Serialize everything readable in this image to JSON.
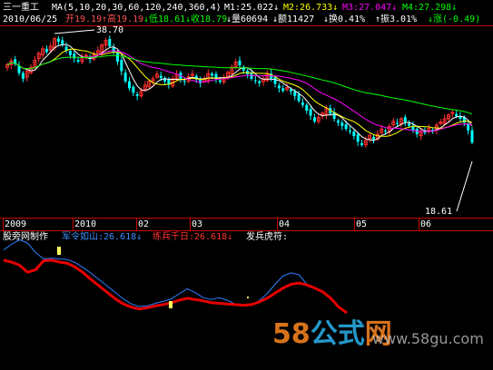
{
  "header": {
    "stock_name": "三一重工",
    "ma_label": "MA(5,10,20,30,60,120,240,360,4)",
    "m1": "M1:25.022↓",
    "m2": "M2:26.733↓",
    "m3": "M3:27.047↓",
    "m4": "M4:27.298↓",
    "date": "2010/06/25",
    "open": "开19.19",
    "high": "↑高19.19",
    "low": "↓低18.61",
    "close": "↓收18.79",
    "volume": "↓量60694",
    "amount": "↓额11427",
    "turnover": "↓换0.41%",
    "amplitude": "↑振3.01%",
    "change": "↓涨(-0.49)"
  },
  "colors": {
    "m1": "#ffffff",
    "m2": "#ffff00",
    "m3": "#ff00ff",
    "m4": "#00ff00",
    "up": "#ff3030",
    "down": "#00ffff",
    "bg": "#000000",
    "axis": "#c80000",
    "price_label": "#ffffff",
    "line_generals": "#2f7fff",
    "line_soldiers": "#e60000"
  },
  "indicator": {
    "title": "股旁网制作",
    "l1": "军令如山:26.618↓",
    "l2": "练兵千日:26.618↓",
    "l3": "发兵虎符:"
  },
  "watermark": {
    "part1": "58",
    "part2": "公式",
    "part3": "网",
    "url": "www.58gu.com"
  },
  "chart_data": [
    {
      "type": "candlestick",
      "title": "三一重工",
      "time_labels": [
        "2009",
        "2010",
        "02",
        "03",
        "04",
        "05",
        "06"
      ],
      "annotations": [
        {
          "label": "38.70",
          "kind": "period high"
        },
        {
          "label": "18.61",
          "kind": "period low"
        }
      ],
      "close": [
        33.8,
        34.4,
        33.9,
        32.5,
        31.6,
        32.8,
        33.4,
        34.5,
        35.6,
        36.3,
        35.8,
        36.7,
        37.9,
        37.4,
        36.9,
        36.0,
        35.3,
        34.8,
        34.3,
        34.9,
        35.3,
        34.7,
        35.4,
        36.0,
        36.9,
        37.6,
        36.7,
        35.8,
        34.3,
        32.8,
        31.2,
        30.1,
        29.4,
        28.9,
        29.7,
        30.6,
        31.2,
        31.6,
        32.3,
        31.7,
        31.2,
        30.7,
        31.6,
        32.3,
        31.5,
        31.2,
        31.9,
        32.3,
        31.5,
        30.9,
        31.5,
        32.4,
        32.1,
        31.6,
        31.1,
        31.7,
        32.6,
        33.4,
        34.2,
        33.7,
        32.9,
        32.3,
        31.6,
        31.2,
        30.9,
        31.6,
        32.4,
        31.6,
        30.8,
        30.1,
        29.7,
        30.2,
        29.6,
        28.9,
        28.1,
        27.5,
        26.6,
        25.8,
        24.9,
        25.5,
        26.2,
        27.0,
        26.1,
        25.3,
        24.7,
        24.2,
        23.7,
        23.3,
        22.6,
        21.7,
        21.2,
        21.9,
        22.7,
        22.1,
        22.9,
        23.7,
        23.3,
        24.1,
        24.9,
        24.5,
        25.3,
        24.8,
        24.2,
        23.5,
        22.9,
        23.4,
        23.1,
        23.8,
        23.5,
        24.3,
        24.8,
        25.3,
        25.9,
        26.3,
        25.7,
        25.3,
        24.7,
        23.5,
        21.6
      ],
      "ma": [
        {
          "name": "M1",
          "period": 5
        },
        {
          "name": "M2",
          "period": 10
        },
        {
          "name": "M3",
          "period": 20
        },
        {
          "name": "M4",
          "period": 60
        }
      ],
      "axes_ticks": false
    },
    {
      "type": "line",
      "title": "股旁网制作",
      "series": [
        {
          "name": "军令如山",
          "color": "#2f7fff",
          "values": [
            0.99,
            1.08,
            1.15,
            1.1,
            0.95,
            0.85,
            0.86,
            0.85,
            0.84,
            0.79,
            0.71,
            0.62,
            0.52,
            0.42,
            0.32,
            0.22,
            0.14,
            0.1,
            0.11,
            0.15,
            0.18,
            0.22,
            0.3,
            0.38,
            0.32,
            0.24,
            0.21,
            0.24,
            0.2,
            0.14,
            0.11,
            0.12,
            0.19,
            0.3,
            0.45,
            0.58,
            0.63,
            0.6,
            0.45,
            0.38,
            0.33,
            0.23,
            0.09,
            0.0
          ]
        },
        {
          "name": "练兵千日",
          "color": "#e60000",
          "values": [
            0.83,
            0.8,
            0.75,
            0.64,
            0.68,
            0.82,
            0.83,
            0.8,
            0.78,
            0.72,
            0.63,
            0.52,
            0.42,
            0.32,
            0.22,
            0.14,
            0.09,
            0.06,
            0.08,
            0.11,
            0.13,
            0.16,
            0.2,
            0.23,
            0.21,
            0.19,
            0.16,
            0.15,
            0.14,
            0.13,
            0.12,
            0.13,
            0.17,
            0.23,
            0.31,
            0.39,
            0.45,
            0.47,
            0.44,
            0.39,
            0.33,
            0.23,
            0.09,
            0.0
          ]
        }
      ]
    }
  ]
}
